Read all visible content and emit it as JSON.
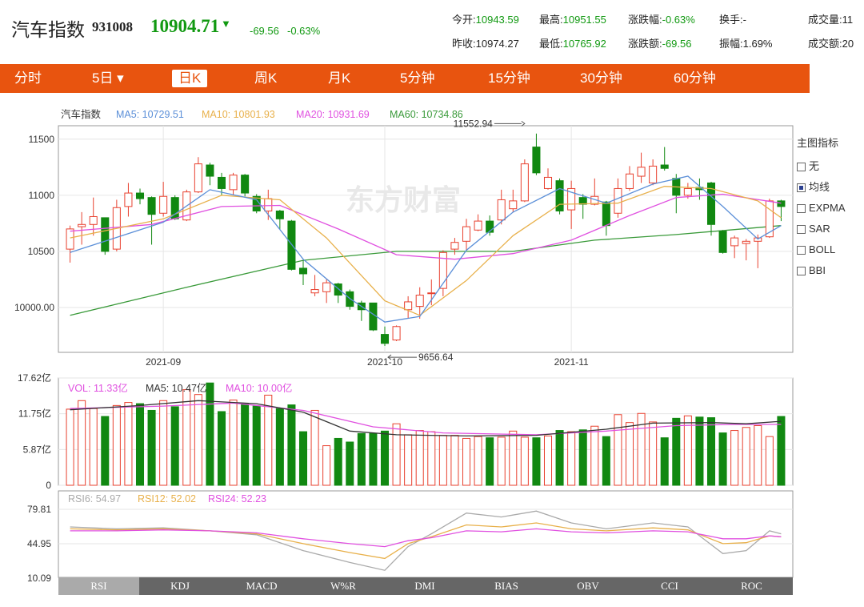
{
  "header": {
    "name": "汽车指数",
    "code": "931008",
    "price": "10904.71",
    "arrow": "▼",
    "change": "-69.56",
    "change_pct": "-0.63%",
    "stats": {
      "open_label": "今开:",
      "open": "10943.59",
      "high_label": "最高:",
      "high": "10951.55",
      "pct_label": "涨跌幅:",
      "pct": "-0.63%",
      "turnover_label": "换手:",
      "turnover": "-",
      "volume_label": "成交量:",
      "volume": "11",
      "prev_label": "昨收:",
      "prev": "10974.27",
      "low_label": "最低:",
      "low": "10765.92",
      "chg_label": "涨跌额:",
      "chg": "-69.56",
      "amp_label": "振幅:",
      "amp": "1.69%",
      "amount_label": "成交额:",
      "amount": "20"
    }
  },
  "tabs": [
    "分时",
    "5日 ▾",
    "日K",
    "周K",
    "月K",
    "5分钟",
    "15分钟",
    "30分钟",
    "60分钟"
  ],
  "active_tab": "日K",
  "sidebar": {
    "title": "主图指标",
    "items": [
      {
        "label": "无",
        "checked": false
      },
      {
        "label": "均线",
        "checked": true
      },
      {
        "label": "EXPMA",
        "checked": false
      },
      {
        "label": "SAR",
        "checked": false
      },
      {
        "label": "BOLL",
        "checked": false
      },
      {
        "label": "BBI",
        "checked": false
      }
    ]
  },
  "bottom_tabs": [
    "RSI",
    "KDJ",
    "MACD",
    "W%R",
    "DMI",
    "BIAS",
    "OBV",
    "CCI",
    "ROC"
  ],
  "watermark": "东方财富",
  "colors": {
    "up": "#e8412f",
    "down": "#118811",
    "ma5": "#5b8fd8",
    "ma10": "#e8b04a",
    "ma20": "#e050e0",
    "ma60": "#3a9a3a",
    "accent": "#e8540f",
    "price_green": "#119911"
  },
  "chart_data": [
    {
      "type": "candlestick",
      "title": "汽车指数",
      "legend": [
        {
          "name": "汽车指数",
          "text": "汽车指数"
        },
        {
          "name": "MA5",
          "text": "MA5: 10729.51"
        },
        {
          "name": "MA10",
          "text": "MA10: 10801.93"
        },
        {
          "name": "MA20",
          "text": "MA20: 10931.69"
        },
        {
          "name": "MA60",
          "text": "MA60: 10734.86"
        }
      ],
      "yticks": [
        "11500",
        "11000",
        "10500",
        "10000.00"
      ],
      "ytick_values": [
        11500,
        11000,
        10500,
        10000
      ],
      "ylim": [
        9600,
        11620
      ],
      "xticks": [
        {
          "label": "2021-09",
          "index": 8
        },
        {
          "label": "2021-10",
          "index": 27
        },
        {
          "label": "2021-11",
          "index": 43
        }
      ],
      "annotations": [
        {
          "text": "11552.94",
          "index": 39,
          "value": 11552.94
        },
        {
          "text": "9656.64",
          "index": 27,
          "value": 9656.64
        }
      ],
      "candles": [
        {
          "o": 10520,
          "c": 10700,
          "h": 10730,
          "l": 10400
        },
        {
          "o": 10720,
          "c": 10740,
          "h": 10850,
          "l": 10560
        },
        {
          "o": 10740,
          "c": 10810,
          "h": 10980,
          "l": 10640
        },
        {
          "o": 10800,
          "c": 10500,
          "h": 10800,
          "l": 10470
        },
        {
          "o": 10520,
          "c": 10890,
          "h": 10960,
          "l": 10500
        },
        {
          "o": 10900,
          "c": 11020,
          "h": 11110,
          "l": 10810
        },
        {
          "o": 11020,
          "c": 10970,
          "h": 11060,
          "l": 10920
        },
        {
          "o": 10980,
          "c": 10830,
          "h": 10990,
          "l": 10560
        },
        {
          "o": 10840,
          "c": 10990,
          "h": 11120,
          "l": 10810
        },
        {
          "o": 10980,
          "c": 10790,
          "h": 11000,
          "l": 10780
        },
        {
          "o": 10780,
          "c": 11030,
          "h": 11050,
          "l": 10770
        },
        {
          "o": 11030,
          "c": 11280,
          "h": 11340,
          "l": 11020
        },
        {
          "o": 11270,
          "c": 11170,
          "h": 11290,
          "l": 11090
        },
        {
          "o": 11160,
          "c": 11060,
          "h": 11200,
          "l": 11000
        },
        {
          "o": 11050,
          "c": 11180,
          "h": 11200,
          "l": 11000
        },
        {
          "o": 11180,
          "c": 11020,
          "h": 11190,
          "l": 10990
        },
        {
          "o": 10990,
          "c": 10860,
          "h": 11010,
          "l": 10840
        },
        {
          "o": 10860,
          "c": 10970,
          "h": 11050,
          "l": 10780
        },
        {
          "o": 10860,
          "c": 10790,
          "h": 10870,
          "l": 10700
        },
        {
          "o": 10770,
          "c": 10340,
          "h": 10780,
          "l": 10330
        },
        {
          "o": 10350,
          "c": 10300,
          "h": 10420,
          "l": 10200
        },
        {
          "o": 10130,
          "c": 10160,
          "h": 10290,
          "l": 10100
        },
        {
          "o": 10140,
          "c": 10220,
          "h": 10250,
          "l": 10040
        },
        {
          "o": 10210,
          "c": 10110,
          "h": 10220,
          "l": 10040
        },
        {
          "o": 10140,
          "c": 10010,
          "h": 10160,
          "l": 9980
        },
        {
          "o": 10040,
          "c": 9980,
          "h": 10060,
          "l": 9880
        },
        {
          "o": 10040,
          "c": 9800,
          "h": 10040,
          "l": 9790
        },
        {
          "o": 9760,
          "c": 9680,
          "h": 9830,
          "l": 9657
        },
        {
          "o": 9710,
          "c": 9830,
          "h": 9840,
          "l": 9700
        },
        {
          "o": 9980,
          "c": 10050,
          "h": 10100,
          "l": 9900
        },
        {
          "o": 10010,
          "c": 10110,
          "h": 10180,
          "l": 9900
        },
        {
          "o": 10130,
          "c": 10130,
          "h": 10250,
          "l": 10020
        },
        {
          "o": 10170,
          "c": 10490,
          "h": 10510,
          "l": 10100
        },
        {
          "o": 10520,
          "c": 10580,
          "h": 10620,
          "l": 10470
        },
        {
          "o": 10590,
          "c": 10720,
          "h": 10790,
          "l": 10510
        },
        {
          "o": 10690,
          "c": 10770,
          "h": 10830,
          "l": 10680
        },
        {
          "o": 10770,
          "c": 10670,
          "h": 10820,
          "l": 10640
        },
        {
          "o": 10780,
          "c": 10960,
          "h": 11050,
          "l": 10740
        },
        {
          "o": 10880,
          "c": 10950,
          "h": 11050,
          "l": 10850
        },
        {
          "o": 10950,
          "c": 11280,
          "h": 11320,
          "l": 10940
        },
        {
          "o": 11430,
          "c": 11200,
          "h": 11550,
          "l": 11180
        },
        {
          "o": 11060,
          "c": 11160,
          "h": 11240,
          "l": 11050
        },
        {
          "o": 11130,
          "c": 10860,
          "h": 11150,
          "l": 10830
        },
        {
          "o": 10870,
          "c": 11060,
          "h": 11130,
          "l": 10700
        },
        {
          "o": 10980,
          "c": 10920,
          "h": 11010,
          "l": 10790
        },
        {
          "o": 10920,
          "c": 10990,
          "h": 11150,
          "l": 10910
        },
        {
          "o": 10940,
          "c": 10730,
          "h": 10950,
          "l": 10640
        },
        {
          "o": 10840,
          "c": 11060,
          "h": 11150,
          "l": 10800
        },
        {
          "o": 11060,
          "c": 11190,
          "h": 11260,
          "l": 11040
        },
        {
          "o": 11170,
          "c": 11250,
          "h": 11380,
          "l": 11110
        },
        {
          "o": 11110,
          "c": 11260,
          "h": 11320,
          "l": 11090
        },
        {
          "o": 11270,
          "c": 11240,
          "h": 11430,
          "l": 11220
        },
        {
          "o": 11150,
          "c": 11000,
          "h": 11190,
          "l": 10840
        },
        {
          "o": 11000,
          "c": 11060,
          "h": 11110,
          "l": 10970
        },
        {
          "o": 11070,
          "c": 11050,
          "h": 11150,
          "l": 10960
        },
        {
          "o": 11110,
          "c": 10740,
          "h": 11120,
          "l": 10640
        },
        {
          "o": 10680,
          "c": 10490,
          "h": 10690,
          "l": 10480
        },
        {
          "o": 10550,
          "c": 10620,
          "h": 10640,
          "l": 10440
        },
        {
          "o": 10570,
          "c": 10590,
          "h": 10610,
          "l": 10420
        },
        {
          "o": 10590,
          "c": 10620,
          "h": 10650,
          "l": 10350
        },
        {
          "o": 10630,
          "c": 10950,
          "h": 10970,
          "l": 10620
        },
        {
          "o": 10950,
          "c": 10900,
          "h": 10960,
          "l": 10770
        }
      ],
      "ma5": [
        [
          0,
          10490
        ],
        [
          8,
          10760
        ],
        [
          12,
          11050
        ],
        [
          16,
          10960
        ],
        [
          20,
          10430
        ],
        [
          24,
          10080
        ],
        [
          27,
          9870
        ],
        [
          30,
          9920
        ],
        [
          34,
          10510
        ],
        [
          38,
          10850
        ],
        [
          42,
          11060
        ],
        [
          46,
          10930
        ],
        [
          50,
          11100
        ],
        [
          53,
          11170
        ],
        [
          56,
          10900
        ],
        [
          59,
          10610
        ],
        [
          61,
          10730
        ]
      ],
      "ma10": [
        [
          0,
          10620
        ],
        [
          8,
          10790
        ],
        [
          13,
          11000
        ],
        [
          18,
          10960
        ],
        [
          22,
          10620
        ],
        [
          27,
          10060
        ],
        [
          30,
          9930
        ],
        [
          34,
          10240
        ],
        [
          38,
          10640
        ],
        [
          42,
          10920
        ],
        [
          47,
          10930
        ],
        [
          51,
          11080
        ],
        [
          55,
          11060
        ],
        [
          59,
          10950
        ],
        [
          61,
          10800
        ]
      ],
      "ma20": [
        [
          0,
          10680
        ],
        [
          7,
          10740
        ],
        [
          13,
          10900
        ],
        [
          18,
          10910
        ],
        [
          23,
          10700
        ],
        [
          28,
          10470
        ],
        [
          33,
          10430
        ],
        [
          38,
          10480
        ],
        [
          43,
          10600
        ],
        [
          48,
          10820
        ],
        [
          52,
          10980
        ],
        [
          56,
          11010
        ],
        [
          61,
          10930
        ]
      ],
      "ma60": [
        [
          0,
          9930
        ],
        [
          10,
          10180
        ],
        [
          20,
          10420
        ],
        [
          28,
          10500
        ],
        [
          38,
          10500
        ],
        [
          45,
          10600
        ],
        [
          52,
          10650
        ],
        [
          61,
          10730
        ]
      ]
    },
    {
      "type": "bar",
      "title": "VOL",
      "legend": [
        {
          "name": "VOL",
          "text": "VOL: 11.33亿"
        },
        {
          "name": "MA5",
          "text": "MA5: 10.47亿"
        },
        {
          "name": "MA10",
          "text": "MA10: 10.00亿"
        }
      ],
      "yticks": [
        "17.62亿",
        "11.75亿",
        "5.87亿",
        "0"
      ],
      "ytick_values": [
        17.62,
        11.75,
        5.87,
        0
      ],
      "ylim": [
        0,
        17.62
      ],
      "values": [
        12.5,
        13.9,
        12.6,
        11.3,
        13.1,
        13.6,
        13.4,
        12.3,
        13.9,
        12.9,
        15.7,
        14.9,
        16.8,
        12.1,
        14.0,
        13.4,
        13.0,
        14.8,
        12.6,
        13.2,
        8.8,
        12.3,
        6.5,
        7.7,
        7.1,
        8.5,
        8.5,
        8.9,
        10.1,
        8.3,
        9.0,
        8.8,
        8.2,
        8.2,
        7.7,
        8.0,
        7.8,
        7.9,
        8.9,
        7.9,
        7.8,
        8.1,
        9.0,
        8.8,
        9.1,
        9.7,
        8.0,
        11.6,
        10.3,
        11.8,
        10.4,
        7.8,
        11.0,
        11.4,
        11.2,
        11.1,
        8.6,
        9.0,
        9.5,
        9.8,
        8.0,
        11.3
      ],
      "ma5": [
        [
          0,
          12.4
        ],
        [
          6,
          13.1
        ],
        [
          11,
          13.9
        ],
        [
          16,
          13.4
        ],
        [
          20,
          12.0
        ],
        [
          24,
          8.9
        ],
        [
          28,
          8.3
        ],
        [
          34,
          8.1
        ],
        [
          40,
          8.2
        ],
        [
          46,
          9.2
        ],
        [
          50,
          10.2
        ],
        [
          55,
          10.3
        ],
        [
          58,
          10.1
        ],
        [
          61,
          10.5
        ]
      ],
      "ma10": [
        [
          0,
          12.6
        ],
        [
          8,
          13.0
        ],
        [
          14,
          13.5
        ],
        [
          20,
          12.3
        ],
        [
          26,
          9.6
        ],
        [
          32,
          8.6
        ],
        [
          40,
          8.3
        ],
        [
          46,
          8.9
        ],
        [
          52,
          9.8
        ],
        [
          57,
          10.0
        ],
        [
          61,
          10.0
        ]
      ]
    },
    {
      "type": "line",
      "title": "RSI",
      "legend": [
        {
          "name": "RSI6",
          "text": "RSI6: 54.97"
        },
        {
          "name": "RSI12",
          "text": "RSI12: 52.02"
        },
        {
          "name": "RSI24",
          "text": "RSI24: 52.23"
        }
      ],
      "yticks": [
        "79.81",
        "44.95",
        "10.09"
      ],
      "ytick_values": [
        79.81,
        44.95,
        10.09
      ],
      "ylim": [
        10.09,
        79.81
      ],
      "series": [
        {
          "name": "RSI6",
          "points": [
            [
              0,
              62
            ],
            [
              4,
              60
            ],
            [
              8,
              61
            ],
            [
              12,
              58
            ],
            [
              16,
              54
            ],
            [
              20,
              38
            ],
            [
              24,
              26
            ],
            [
              27,
              18
            ],
            [
              29,
              42
            ],
            [
              31,
              55
            ],
            [
              34,
              76
            ],
            [
              37,
              72
            ],
            [
              40,
              78
            ],
            [
              43,
              66
            ],
            [
              46,
              60
            ],
            [
              50,
              66
            ],
            [
              53,
              62
            ],
            [
              56,
              35
            ],
            [
              58,
              38
            ],
            [
              60,
              58
            ],
            [
              61,
              55
            ]
          ]
        },
        {
          "name": "RSI12",
          "points": [
            [
              0,
              60
            ],
            [
              4,
              59
            ],
            [
              8,
              60
            ],
            [
              12,
              58
            ],
            [
              16,
              55
            ],
            [
              20,
              45
            ],
            [
              24,
              36
            ],
            [
              27,
              30
            ],
            [
              29,
              45
            ],
            [
              31,
              52
            ],
            [
              34,
              64
            ],
            [
              37,
              62
            ],
            [
              40,
              66
            ],
            [
              43,
              60
            ],
            [
              46,
              58
            ],
            [
              50,
              61
            ],
            [
              53,
              59
            ],
            [
              56,
              45
            ],
            [
              58,
              46
            ],
            [
              60,
              53
            ],
            [
              61,
              52
            ]
          ]
        },
        {
          "name": "RSI24",
          "points": [
            [
              0,
              58
            ],
            [
              4,
              58
            ],
            [
              8,
              59
            ],
            [
              12,
              58
            ],
            [
              16,
              56
            ],
            [
              20,
              50
            ],
            [
              24,
              45
            ],
            [
              27,
              42
            ],
            [
              29,
              48
            ],
            [
              31,
              51
            ],
            [
              34,
              58
            ],
            [
              37,
              57
            ],
            [
              40,
              60
            ],
            [
              43,
              57
            ],
            [
              46,
              56
            ],
            [
              50,
              58
            ],
            [
              53,
              57
            ],
            [
              56,
              50
            ],
            [
              58,
              50
            ],
            [
              60,
              53
            ],
            [
              61,
              52
            ]
          ]
        }
      ]
    }
  ]
}
